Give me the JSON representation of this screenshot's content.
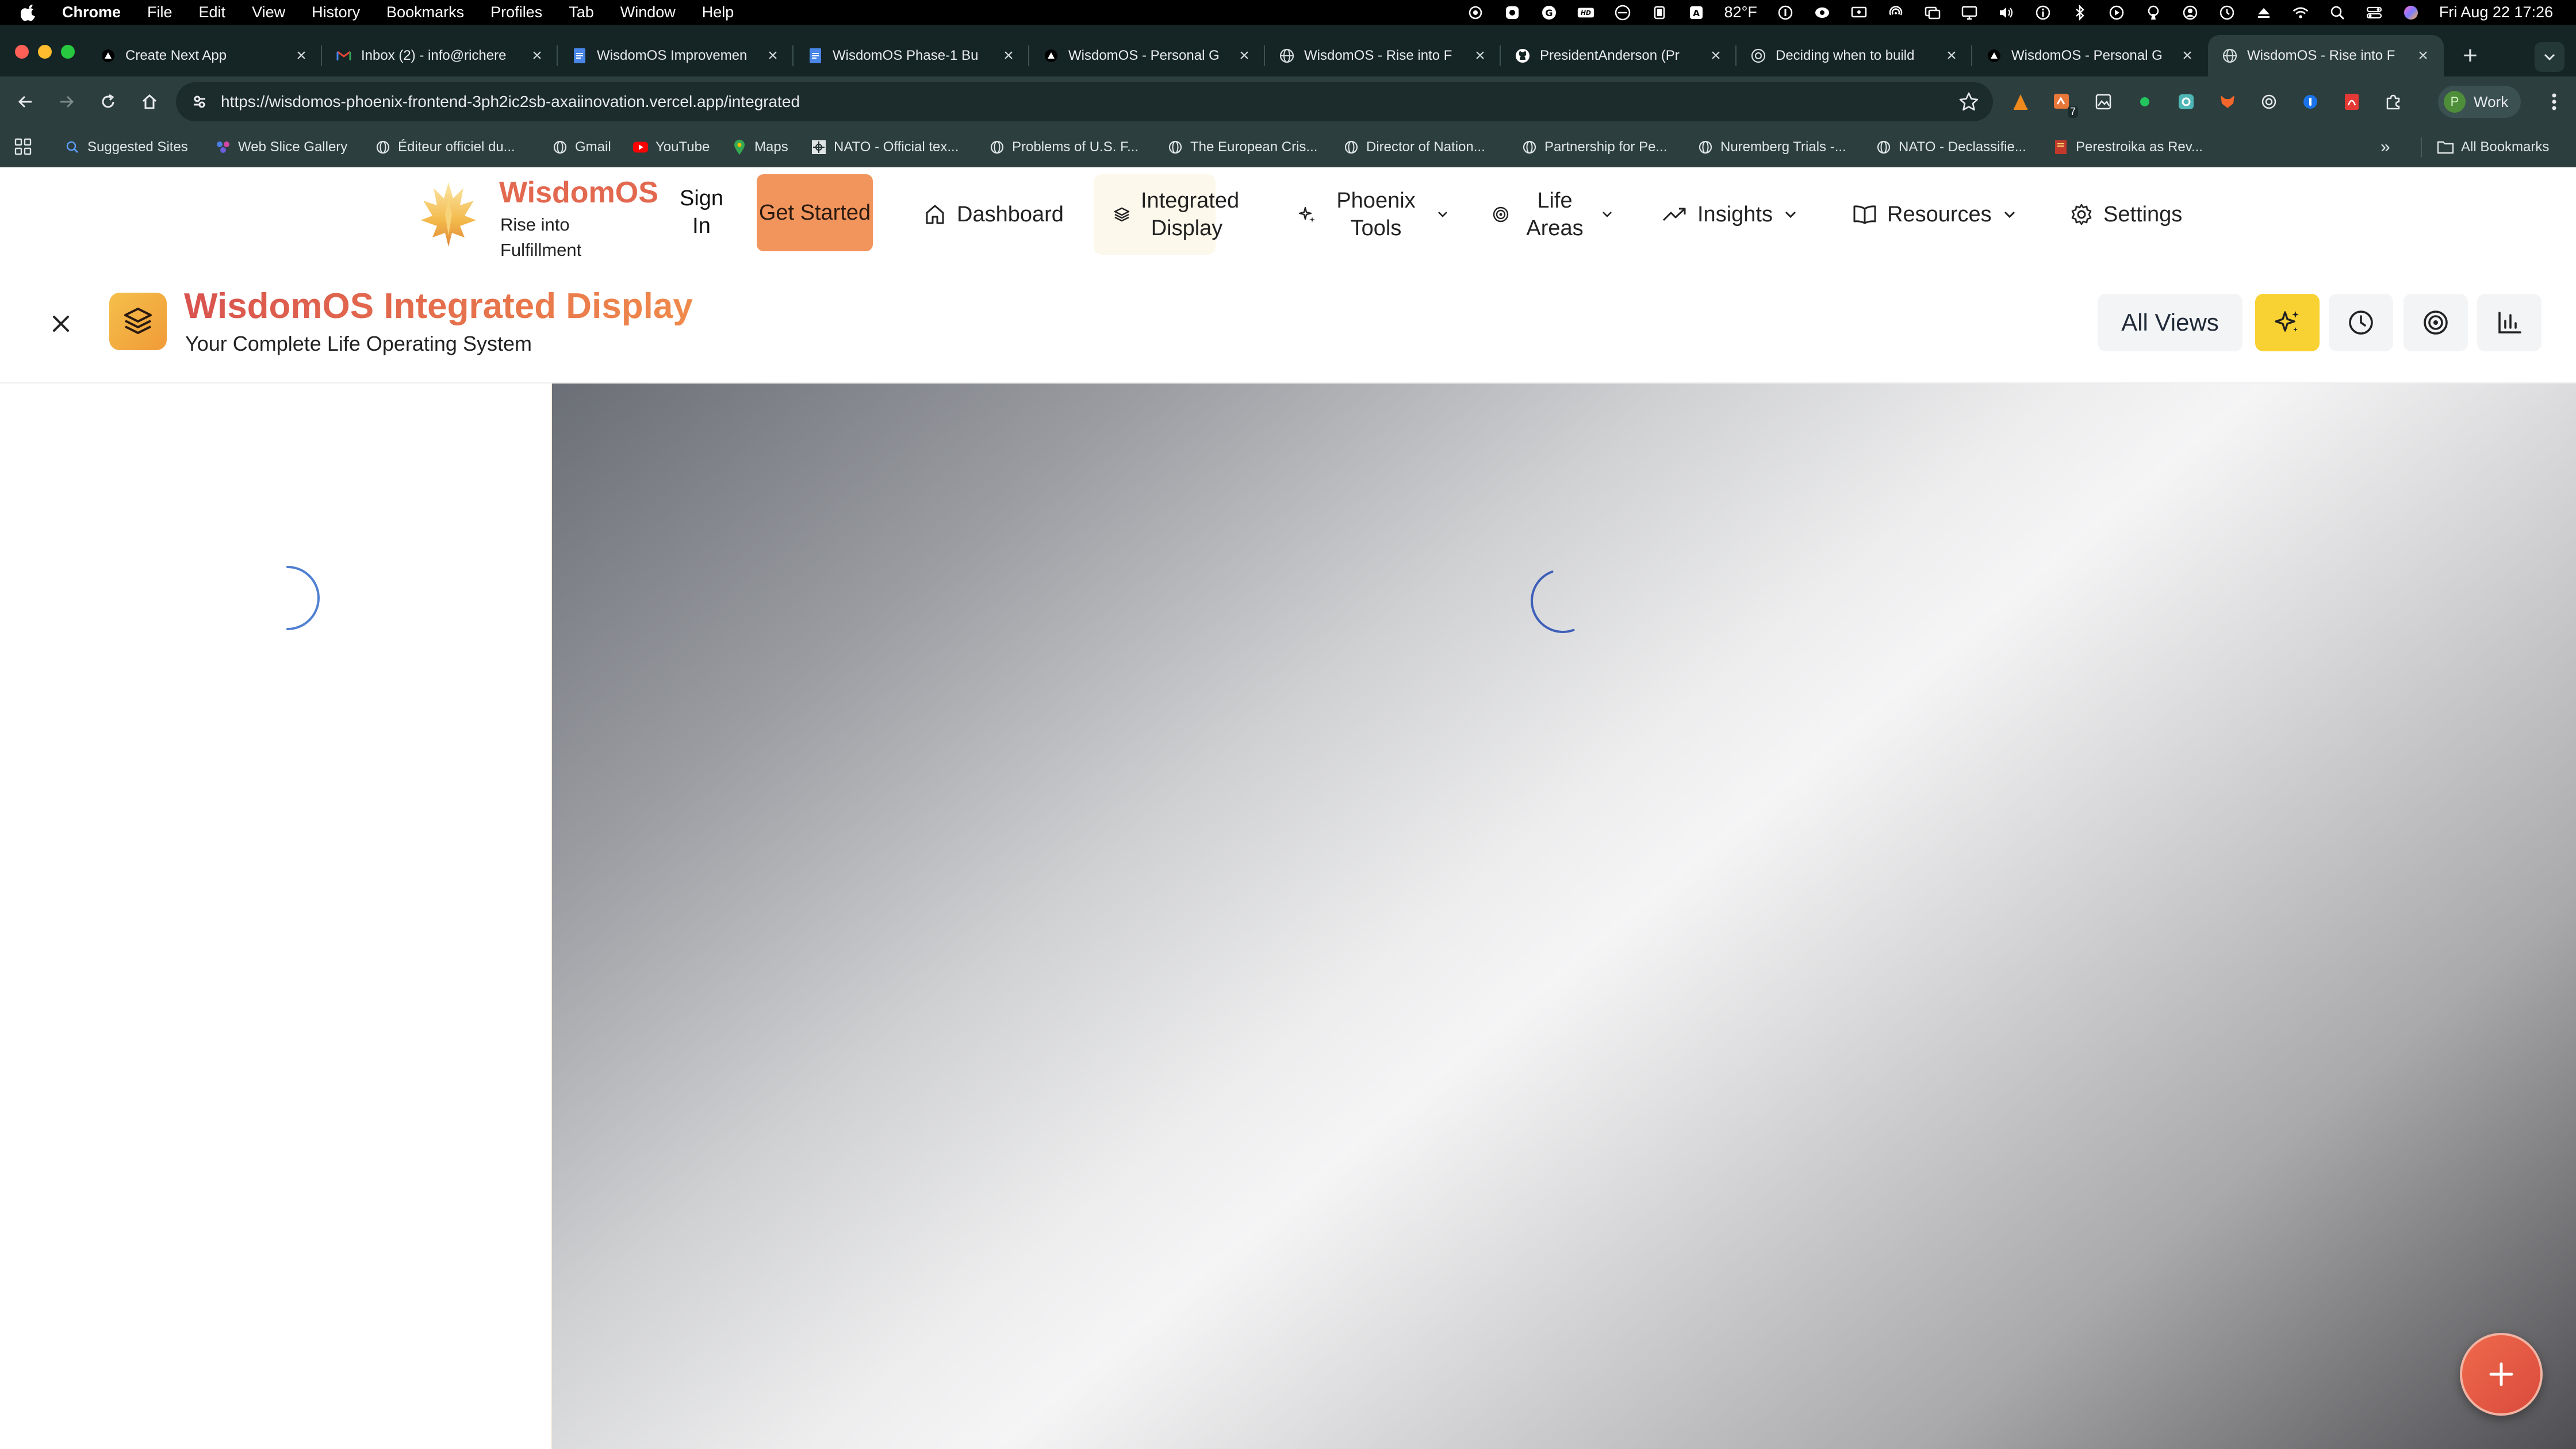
{
  "menubar": {
    "app": "Chrome",
    "menus": [
      "File",
      "Edit",
      "View",
      "History",
      "Bookmarks",
      "Profiles",
      "Tab",
      "Window",
      "Help"
    ],
    "temperature": "82°F",
    "datetime": "Fri Aug 22  17:26"
  },
  "tabs": [
    {
      "title": "Create Next App",
      "icon": "triangle-icon"
    },
    {
      "title": "Inbox (2) - info@richere",
      "icon": "gmail-icon"
    },
    {
      "title": "WisdomOS Improvemen",
      "icon": "docs-icon"
    },
    {
      "title": "WisdomOS Phase-1 Bu",
      "icon": "docs-icon"
    },
    {
      "title": "WisdomOS - Personal G",
      "icon": "triangle-icon"
    },
    {
      "title": "WisdomOS - Rise into F",
      "icon": "globe-icon"
    },
    {
      "title": "PresidentAnderson (Pr",
      "icon": "github-icon"
    },
    {
      "title": "Deciding when to build",
      "icon": "openai-icon"
    },
    {
      "title": "WisdomOS - Personal G",
      "icon": "triangle-icon"
    },
    {
      "title": "WisdomOS - Rise into F",
      "icon": "globe-icon",
      "active": true
    }
  ],
  "address": {
    "url": "https://wisdomos-phoenix-frontend-3ph2ic2sb-axaiinovation.vercel.app/integrated"
  },
  "extensions_badge": "7",
  "profile": {
    "initial": "P",
    "label": "Work"
  },
  "bookmarks": {
    "items": [
      "Suggested Sites",
      "Web Slice Gallery",
      "Éditeur officiel du...",
      "Gmail",
      "YouTube",
      "Maps",
      "NATO - Official tex...",
      "Problems of U.S. F...",
      "The European Cris...",
      "Director of Nation...",
      "Partnership for Pe...",
      "Nuremberg Trials -...",
      "NATO - Declassifie...",
      "Perestroika as Rev..."
    ],
    "all": "All Bookmarks"
  },
  "site": {
    "brand": "WisdomOS",
    "tagline": "Rise into Fulfillment",
    "sign_in": "Sign In",
    "get_started": "Get Started",
    "nav": {
      "dashboard": "Dashboard",
      "integrated": "Integrated Display",
      "phoenix": "Phoenix Tools",
      "life": "Life Areas",
      "insights": "Insights",
      "resources": "Resources",
      "settings": "Settings"
    }
  },
  "panel": {
    "title": "WisdomOS Integrated Display",
    "subtitle": "Your Complete Life Operating System",
    "all_views": "All Views"
  },
  "colors": {
    "brand": "#e2684f",
    "cta": "#f2955d",
    "accent_yellow": "#f8d232",
    "fab": "#e15844",
    "chrome_frame": "#2c3e3e"
  }
}
